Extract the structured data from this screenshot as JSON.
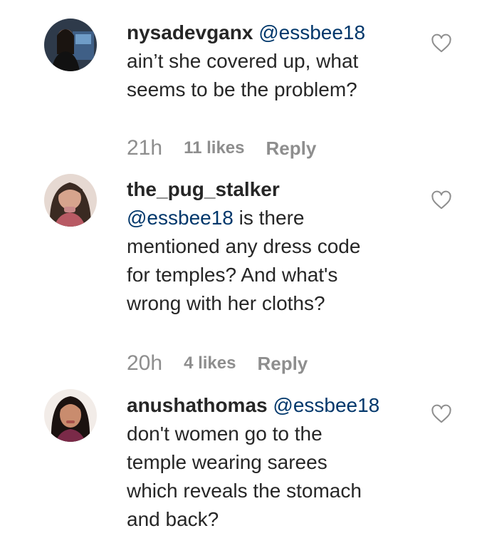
{
  "comments": [
    {
      "username": "nysadevganx",
      "mention": "@essbee18",
      "text_lines": [
        "ain’t she covered up, what",
        "seems to be the problem?"
      ],
      "time": "21h",
      "likes": "11 likes",
      "reply": "Reply"
    },
    {
      "username": "the_pug_stalker",
      "mention": "@essbee18",
      "text_lines": [
        "is there",
        "mentioned any dress code",
        "for temples? And what's",
        "wrong with her cloths?"
      ],
      "time": "20h",
      "likes": "4 likes",
      "reply": "Reply"
    },
    {
      "username": "anushathomas",
      "mention": "@essbee18",
      "text_lines": [
        "don't women go to the",
        "temple wearing sarees",
        "which reveals the stomach",
        "and back?"
      ]
    }
  ],
  "colors": {
    "text": "#262626",
    "mention": "#00376b",
    "meta": "#8e8e8e"
  }
}
